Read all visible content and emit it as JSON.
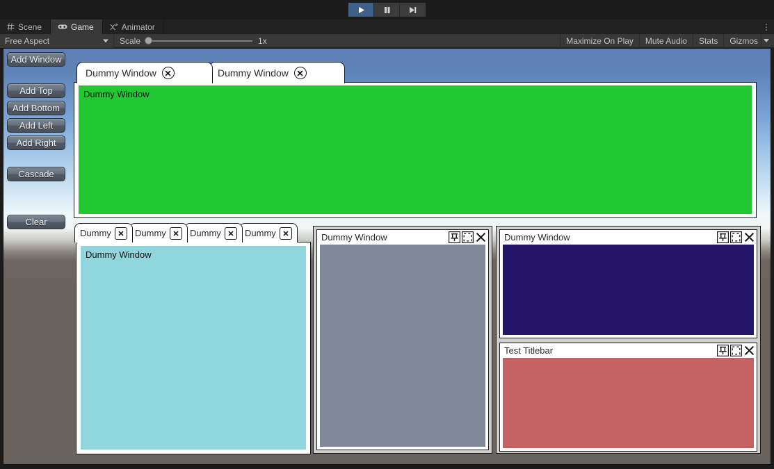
{
  "playbar": {
    "buttons": [
      {
        "name": "play-button",
        "icon": "play-icon",
        "active": true
      },
      {
        "name": "pause-button",
        "icon": "pause-icon",
        "active": false
      },
      {
        "name": "step-button",
        "icon": "step-icon",
        "active": false
      }
    ]
  },
  "editor_tabs": {
    "items": [
      {
        "label": "Scene",
        "icon": "grid-icon",
        "glyph": "▦",
        "active": false
      },
      {
        "label": "Game",
        "icon": "gamepad-icon",
        "glyph": "🎮",
        "active": true
      },
      {
        "label": "Animator",
        "icon": "animator-icon",
        "glyph": "⤳",
        "active": false
      }
    ],
    "overflow_menu": "⋮"
  },
  "game_toolbar": {
    "aspect": "Free Aspect",
    "scale_label": "Scale",
    "scale_value": "1x",
    "maximize_on_play": "Maximize On Play",
    "mute_audio": "Mute Audio",
    "stats": "Stats",
    "gizmos": "Gizmos"
  },
  "left_buttons": [
    {
      "label": "Add Window"
    },
    {
      "label": "Add Top"
    },
    {
      "label": "Add Bottom"
    },
    {
      "label": "Add Left"
    },
    {
      "label": "Add Right"
    },
    {
      "label": "Cascade"
    },
    {
      "label": "Clear"
    }
  ],
  "top_panel": {
    "tabs": [
      {
        "label": "Dummy Window",
        "close": "x",
        "active": true
      },
      {
        "label": "Dummy Window",
        "close": "x",
        "active": false
      }
    ],
    "content_title": "Dummy Window",
    "content_color": "#22c832"
  },
  "bottom_left_panel": {
    "tabs": [
      {
        "label": "Dummy",
        "close": "x",
        "active": false
      },
      {
        "label": "Dummy",
        "close": "x",
        "active": false
      },
      {
        "label": "Dummy",
        "close": "x",
        "active": false
      },
      {
        "label": "Dummy",
        "close": "x",
        "active": true
      }
    ],
    "content_title": "Dummy Window",
    "content_color": "#92d6dd"
  },
  "bottom_mid_panel": {
    "window": {
      "title": "Dummy Window",
      "color": "#808997",
      "icons": [
        {
          "name": "pin-icon"
        },
        {
          "name": "maximize-icon"
        },
        {
          "name": "close-icon"
        }
      ]
    }
  },
  "bottom_right_panel": {
    "windows": [
      {
        "title": "Dummy Window",
        "color": "#251568",
        "icons": [
          {
            "name": "pin-icon"
          },
          {
            "name": "maximize-icon"
          },
          {
            "name": "close-icon"
          }
        ]
      },
      {
        "title": "Test Titlebar",
        "color": "#c56364",
        "icons": [
          {
            "name": "pin-icon"
          },
          {
            "name": "maximize-icon"
          },
          {
            "name": "close-icon"
          }
        ]
      }
    ]
  },
  "colors": {
    "accent_blue": "#3e6189",
    "editor_bg": "#383838",
    "panel_chrome": "#d0d0d0"
  }
}
